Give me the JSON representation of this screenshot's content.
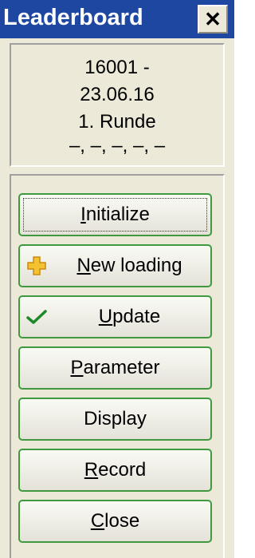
{
  "window": {
    "title": "Leaderboard",
    "close_symbol": "✕"
  },
  "info": {
    "line1": "16001    -",
    "line2": "23.06.16",
    "line3": "1. Runde",
    "line4": "–, –, –, –, –"
  },
  "buttons": [
    {
      "first": "I",
      "rest": "nitialize",
      "icon": null
    },
    {
      "first": "N",
      "rest": "ew loading",
      "icon": "plus-icon"
    },
    {
      "first": "U",
      "rest": "pdate",
      "icon": "checkmark-icon"
    },
    {
      "first": "P",
      "rest": "arameter",
      "icon": null
    },
    {
      "first": "",
      "rest": "Display",
      "icon": null
    },
    {
      "first": "R",
      "rest": "ecord",
      "icon": null
    },
    {
      "first": "C",
      "rest": "lose",
      "icon": null
    }
  ],
  "colors": {
    "titlebar": "#1e47a1",
    "button_border": "#3f9a3f",
    "plus_icon": "#f2c230",
    "checkmark": "#1d8a2a"
  }
}
